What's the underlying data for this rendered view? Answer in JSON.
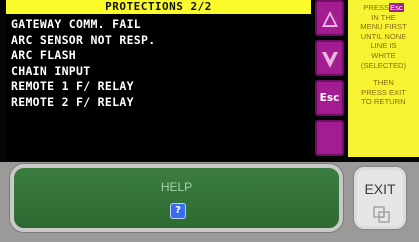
{
  "protections": {
    "title": "PROTECTIONS 2/2",
    "items": [
      "GATEWAY COMM. FAIL",
      "ARC SENSOR NOT RESP.",
      "ARC FLASH",
      "CHAIN INPUT",
      "REMOTE 1 F/ RELAY",
      "REMOTE 2 F/ RELAY"
    ]
  },
  "side_buttons": {
    "up_icon": "triangle-up-icon",
    "down_icon": "triangle-down-icon",
    "esc_label": "Esc"
  },
  "help_note": {
    "line1_prefix": "PRESS",
    "line1_chip": "Esc",
    "line2": "IN THE",
    "line3": "MENU FIRST",
    "line4": "UNTIL NONE",
    "line5": "LINE IS",
    "line6": "WHITE",
    "line7": "(SELECTED)",
    "line8": "THEN",
    "line9": "PRESS EXIT",
    "line10": "TO RETURN"
  },
  "footer": {
    "help_label": "HELP",
    "help_icon": "?",
    "exit_label": "EXIT"
  },
  "colors": {
    "header_yellow": "#fbfb2a",
    "side_magenta": "#a41c92",
    "help_green": "#2d6a33",
    "note_yellow": "#f6f432"
  }
}
